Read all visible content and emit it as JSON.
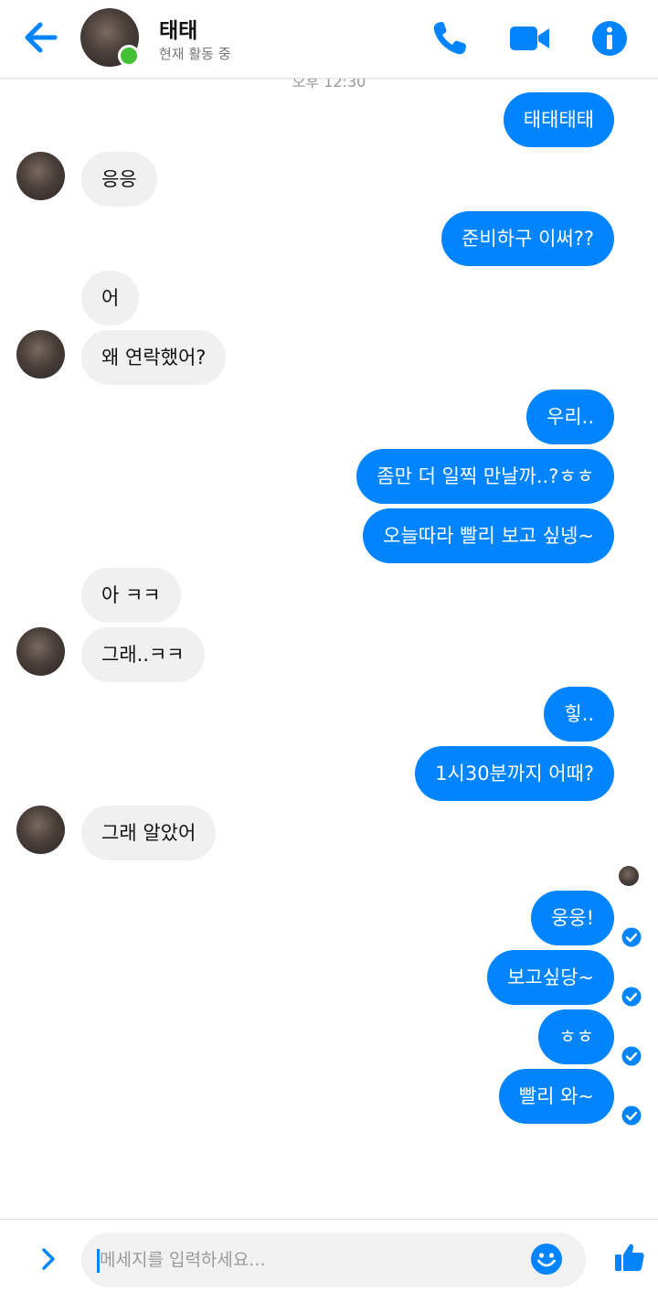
{
  "header": {
    "name": "태태",
    "status": "현재 활동 중"
  },
  "timestamp": "오후 12:30",
  "messages": [
    {
      "from": "me",
      "text": "태태태태"
    },
    {
      "from": "them",
      "text": "응응"
    },
    {
      "from": "me",
      "text": "준비하구 이써??"
    },
    {
      "from": "them",
      "text": "어"
    },
    {
      "from": "them",
      "text": "왜 연락했어?"
    },
    {
      "from": "me",
      "text": "우리.."
    },
    {
      "from": "me",
      "text": "좀만 더 일찍 만날까..?ㅎㅎ"
    },
    {
      "from": "me",
      "text": "오늘따라 빨리 보고 싶넹~"
    },
    {
      "from": "them",
      "text": "아 ㅋㅋ"
    },
    {
      "from": "them",
      "text": "그래..ㅋㅋ"
    },
    {
      "from": "me",
      "text": "힣.."
    },
    {
      "from": "me",
      "text": "1시30분까지 어때?"
    },
    {
      "from": "them",
      "text": "그래 알았어"
    },
    {
      "from": "me",
      "text": "웅웅!"
    },
    {
      "from": "me",
      "text": "보고싶당~"
    },
    {
      "from": "me",
      "text": "ㅎㅎ"
    },
    {
      "from": "me",
      "text": "빨리 와~"
    }
  ],
  "composer": {
    "placeholder": "메세지를 입력하세요...",
    "value": ""
  },
  "colors": {
    "accent": "#0084ff",
    "incoming_bubble": "#f0f0f0",
    "online": "#44c134"
  },
  "icons": [
    "back-arrow-icon",
    "phone-icon",
    "video-camera-icon",
    "info-icon",
    "chevron-right-icon",
    "smiley-icon",
    "thumbs-up-icon",
    "read-check-icon"
  ]
}
